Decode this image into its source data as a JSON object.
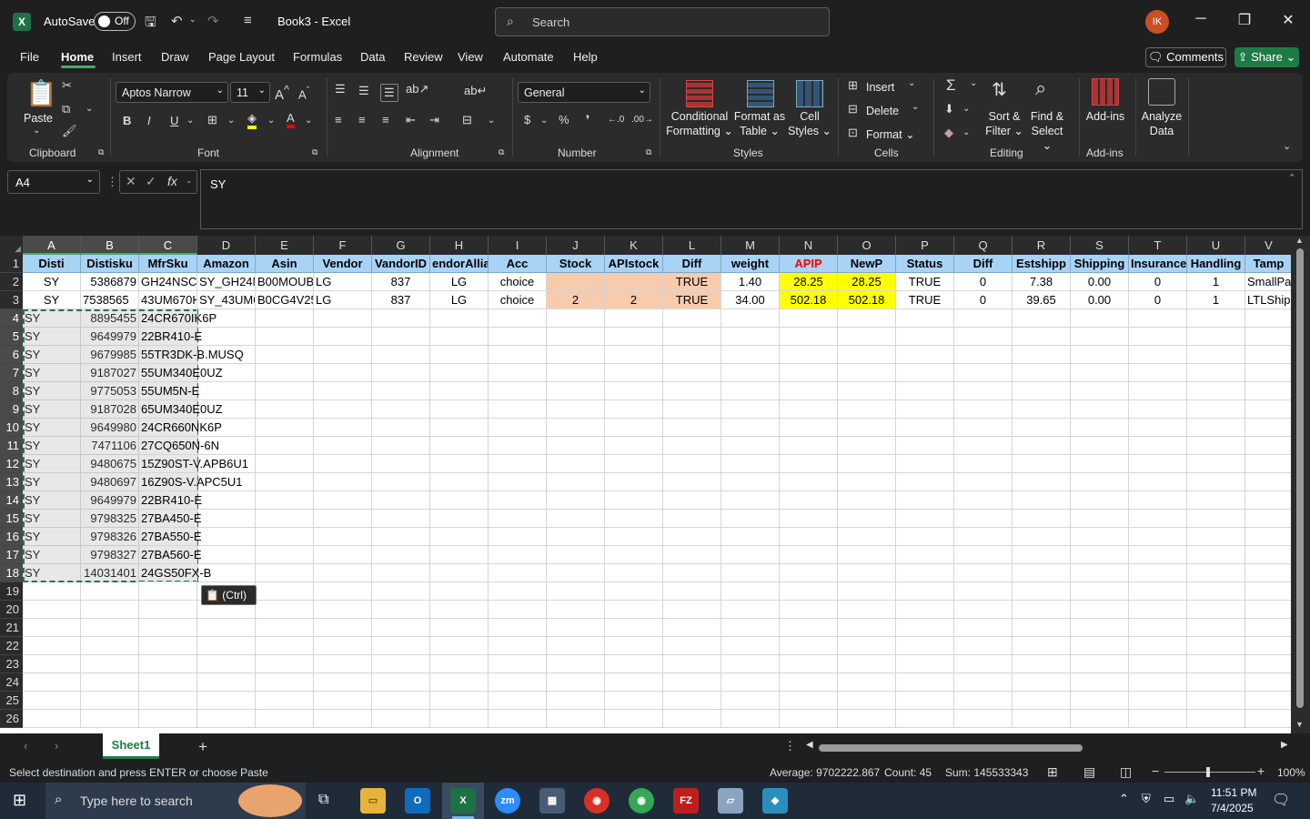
{
  "titlebar": {
    "autosave_label": "AutoSave",
    "autosave_state": "Off",
    "doc_title": "Book3 - Excel",
    "search_placeholder": "Search",
    "user_initials": "IK"
  },
  "menus": [
    "File",
    "Home",
    "Insert",
    "Draw",
    "Page Layout",
    "Formulas",
    "Data",
    "Review",
    "View",
    "Automate",
    "Help"
  ],
  "actions": {
    "comments": "Comments",
    "share": "Share"
  },
  "ribbon": {
    "clipboard": {
      "paste": "Paste",
      "label": "Clipboard"
    },
    "font": {
      "name": "Aptos Narrow",
      "size": "11",
      "label": "Font"
    },
    "alignment": {
      "label": "Alignment"
    },
    "number": {
      "format": "General",
      "label": "Number"
    },
    "styles": {
      "conditional": "Conditional",
      "formatting": "Formatting",
      "format_as": "Format as",
      "table": "Table",
      "cell": "Cell",
      "styles": "Styles",
      "label": "Styles"
    },
    "cells": {
      "insert": "Insert",
      "delete": "Delete",
      "format": "Format",
      "label": "Cells"
    },
    "editing": {
      "sort": "Sort &",
      "filter": "Filter",
      "find": "Find &",
      "select": "Select",
      "label": "Editing"
    },
    "addins": {
      "addins": "Add-ins",
      "analyze": "Analyze",
      "data": "Data",
      "label": "Add-ins"
    }
  },
  "formula": {
    "namebox": "A4",
    "content": "SY"
  },
  "columns": [
    "A",
    "B",
    "C",
    "D",
    "E",
    "F",
    "G",
    "H",
    "I",
    "J",
    "K",
    "L",
    "M",
    "N",
    "O",
    "P",
    "Q",
    "R",
    "S",
    "T",
    "U",
    "V"
  ],
  "rows": [
    "1",
    "2",
    "3",
    "4",
    "5",
    "6",
    "7",
    "8",
    "9",
    "10",
    "11",
    "12",
    "13",
    "14",
    "15",
    "16",
    "17",
    "18",
    "19",
    "20",
    "21",
    "22",
    "23",
    "24",
    "25",
    "26"
  ],
  "header_row": [
    "Disti",
    "Distisku",
    "MfrSku",
    "Amazon",
    "Asin",
    "Vendor",
    "VandorID",
    "endorAllia",
    "Acc",
    "Stock",
    "APIstock",
    "Diff",
    "weight",
    "APIP",
    "NewP",
    "Status",
    "Diff",
    "Estshipp",
    "Shipping",
    "Insurance",
    "Handling",
    "Tamp"
  ],
  "data_rows": [
    [
      "SY",
      "5386879",
      "GH24NSC0",
      "SY_GH24N",
      "B00MOUB",
      "LG",
      "837",
      "LG",
      "choice",
      "",
      "",
      "TRUE",
      "1.40",
      "28.25",
      "28.25",
      "TRUE",
      "0",
      "7.38",
      "0.00",
      "0",
      "1",
      "SmallPa"
    ],
    [
      "SY",
      "7538565",
      "43UM670H",
      "SY_43UM6",
      "B0CG4V25",
      "LG",
      "837",
      "LG",
      "choice",
      "2",
      "2",
      "TRUE",
      "34.00",
      "502.18",
      "502.18",
      "TRUE",
      "0",
      "39.65",
      "0.00",
      "0",
      "1",
      "LTLShip"
    ]
  ],
  "pasted_rows": [
    [
      "SY",
      "8895455",
      "24CR670IK6P"
    ],
    [
      "SY",
      "9649979",
      "22BR410-E"
    ],
    [
      "SY",
      "9679985",
      "55TR3DK-B.MUSQ"
    ],
    [
      "SY",
      "9187027",
      "55UM340E0UZ"
    ],
    [
      "SY",
      "9775053",
      "55UM5N-E"
    ],
    [
      "SY",
      "9187028",
      "65UM340E0UZ"
    ],
    [
      "SY",
      "9649980",
      "24CR660NK6P"
    ],
    [
      "SY",
      "7471106",
      "27CQ650N-6N"
    ],
    [
      "SY",
      "9480675",
      "15Z90ST-V.APB6U1"
    ],
    [
      "SY",
      "9480697",
      "16Z90S-V.APC5U1"
    ],
    [
      "SY",
      "9649979",
      "22BR410-E"
    ],
    [
      "SY",
      "9798325",
      "27BA450-E"
    ],
    [
      "SY",
      "9798326",
      "27BA550-E"
    ],
    [
      "SY",
      "9798327",
      "27BA560-E"
    ],
    [
      "SY",
      "14031401",
      "24GS50FX-B"
    ]
  ],
  "paste_options": "(Ctrl)",
  "sheets": [
    "Sheet1"
  ],
  "status": {
    "message": "Select destination and press ENTER or choose Paste",
    "average": "Average: 9702222.867",
    "count": "Count: 45",
    "sum": "Sum: 145533343",
    "zoom": "100%"
  },
  "taskbar": {
    "search": "Type here to search",
    "time": "11:51 PM",
    "date": "7/4/2025"
  },
  "colors": {
    "header_fill": "#a8d3f5",
    "apip_text": "#ff0000",
    "yellow": "#ffff00",
    "salmon": "#f8cbad",
    "accent": "#1e7b45"
  }
}
